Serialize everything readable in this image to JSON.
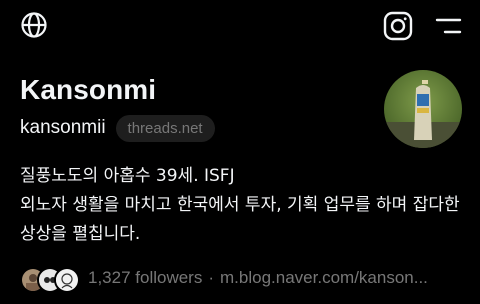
{
  "header": {
    "left_icon": "globe-icon",
    "right_icons": [
      "instagram-icon",
      "menu-icon"
    ]
  },
  "profile": {
    "name": "Kansonmi",
    "handle": "kansonmii",
    "domain_badge": "threads.net",
    "avatar_icon": "profile-photo"
  },
  "bio": {
    "lines": [
      "질풍노도의 아홉수 39세. ISFJ",
      "외노자 생활을 마치고 한국에서 투자, 기획 업무를 하며 잡다한",
      "상상을 펼칩니다."
    ]
  },
  "stats": {
    "followers": "1,327 followers",
    "separator": "·",
    "link": "m.blog.naver.com/kanson..."
  },
  "colors": {
    "background": "#000000",
    "text_primary": "#f3f5f7",
    "text_secondary": "#777777",
    "pill_bg": "#1e1e1e"
  }
}
